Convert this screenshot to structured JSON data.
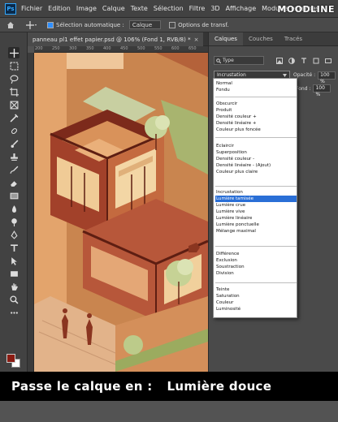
{
  "app": {
    "logo": "Ps",
    "brand": "MOODLINE"
  },
  "menu": [
    "Fichier",
    "Edition",
    "Image",
    "Calque",
    "Texte",
    "Sélection",
    "Filtre",
    "3D",
    "Affichage",
    "Modules externes"
  ],
  "options": {
    "auto_select_label": "Sélection automatique :",
    "auto_select_value": "Calque",
    "transform_label": "Options de transf."
  },
  "document": {
    "tab_title": "panneau pl1 effet papier.psd @ 106% (Fond 1, RVB/8) *",
    "close": "×"
  },
  "ruler": [
    "200",
    "250",
    "300",
    "350",
    "400",
    "450",
    "500",
    "550",
    "600",
    "650"
  ],
  "layers_panel": {
    "tabs": [
      "Calques",
      "Couches",
      "Tracés"
    ],
    "kind_select": "Type",
    "blend_mode": "Incrustation",
    "opacity_label": "Opacité :",
    "opacity_value": "100 %",
    "fill_label": "Fond :",
    "fill_value": "100 %"
  },
  "blend_groups": [
    [
      "Normal",
      "Fondu"
    ],
    [
      "Obscurcir",
      "Produit",
      "Densité couleur +",
      "Densité linéaire +",
      "Couleur plus foncée"
    ],
    [
      "Eclaircir",
      "Superposition",
      "Densité couleur -",
      "Densité linéaire - (Ajout)",
      "Couleur plus claire"
    ],
    [
      "Incrustation",
      "Lumière tamisée",
      "Lumière crue",
      "Lumière vive",
      "Lumière linéaire",
      "Lumière ponctuelle",
      "Mélange maximal"
    ],
    [
      "Différence",
      "Exclusion",
      "Soustraction",
      "Division"
    ],
    [
      "Teinte",
      "Saturation",
      "Couleur",
      "Luminosité"
    ]
  ],
  "selected_blend": "Lumière tamisée",
  "caption": {
    "left": "Passe le calque en :",
    "right": "Lumière douce"
  },
  "colors": {
    "foreground": "#8a1b12",
    "background": "#ffffff",
    "selection": "#2a6fd6"
  }
}
